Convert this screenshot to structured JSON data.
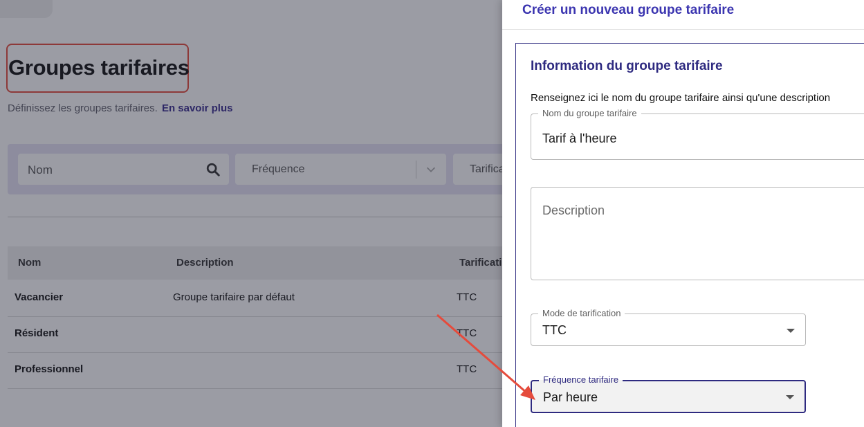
{
  "background_page": {
    "title": "Groupes tarifaires",
    "subtitle": "Définissez les groupes tarifaires.",
    "learn_more_link": "En savoir plus",
    "filters": {
      "name_placeholder": "Nom",
      "frequency_placeholder": "Fréquence",
      "tarification_placeholder": "Tarifica"
    },
    "table": {
      "headers": [
        "Nom",
        "Description",
        "Tarificati"
      ],
      "rows": [
        {
          "name": "Vacancier",
          "description": "Groupe tarifaire par défaut",
          "tarification": "TTC"
        },
        {
          "name": "Résident",
          "description": "",
          "tarification": "TTC"
        },
        {
          "name": "Professionnel",
          "description": "",
          "tarification": "TTC"
        }
      ]
    }
  },
  "drawer": {
    "title": "Créer un nouveau groupe tarifaire",
    "section": {
      "title": "Information du groupe tarifaire",
      "description": "Renseignez ici le nom du groupe tarifaire ainsi qu'une description",
      "fields": {
        "name": {
          "label": "Nom du groupe tarifaire",
          "value": "Tarif à l'heure"
        },
        "description": {
          "placeholder": "Description"
        },
        "pricing_mode": {
          "label": "Mode de tarification",
          "value": "TTC"
        },
        "pricing_frequency": {
          "label": "Fréquence tarifaire",
          "value": "Par heure"
        }
      }
    }
  },
  "colors": {
    "brand": "#3b35b0",
    "section_border": "#2e2a80",
    "highlight_red": "#e54b3c"
  },
  "icons": [
    "search-icon",
    "chevron-down-icon",
    "dropdown-caret-icon",
    "annotation-arrow-icon"
  ]
}
